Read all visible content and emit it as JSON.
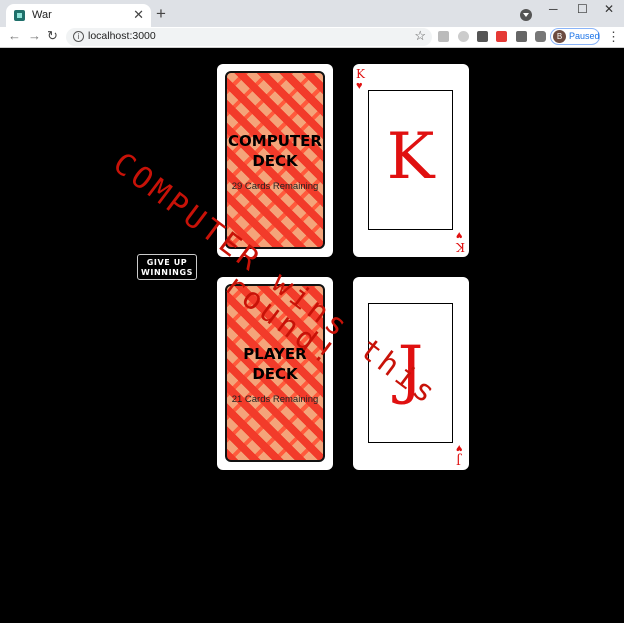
{
  "browser": {
    "tab_title": "War",
    "new_tab_symbol": "+",
    "close_symbol": "✕",
    "url": "localhost:3000",
    "profile_initial": "B",
    "profile_status": "Paused"
  },
  "game": {
    "computer_deck": {
      "title_line1": "COMPUTER",
      "title_line2": "DECK",
      "remaining": "29 Cards Remaining"
    },
    "player_deck": {
      "title_line1": "PLAYER",
      "title_line2": "DECK",
      "remaining": "21 Cards Remaining"
    },
    "computer_card": {
      "rank": "K",
      "suit": "♥",
      "color": "#e01010"
    },
    "player_card": {
      "rank": "J",
      "suit": "♥",
      "color": "#e01010"
    },
    "give_up_button": {
      "line1": "GIVE UP",
      "line2": "WINNINGS"
    },
    "result_message": {
      "line1": "COMPUTER wins this",
      "line2": "round!"
    }
  },
  "icons": [
    "globe-favicon",
    "back-arrow-icon",
    "forward-arrow-icon",
    "reload-icon",
    "info-icon",
    "star-icon",
    "extensions-icon",
    "kebab-menu-icon"
  ]
}
